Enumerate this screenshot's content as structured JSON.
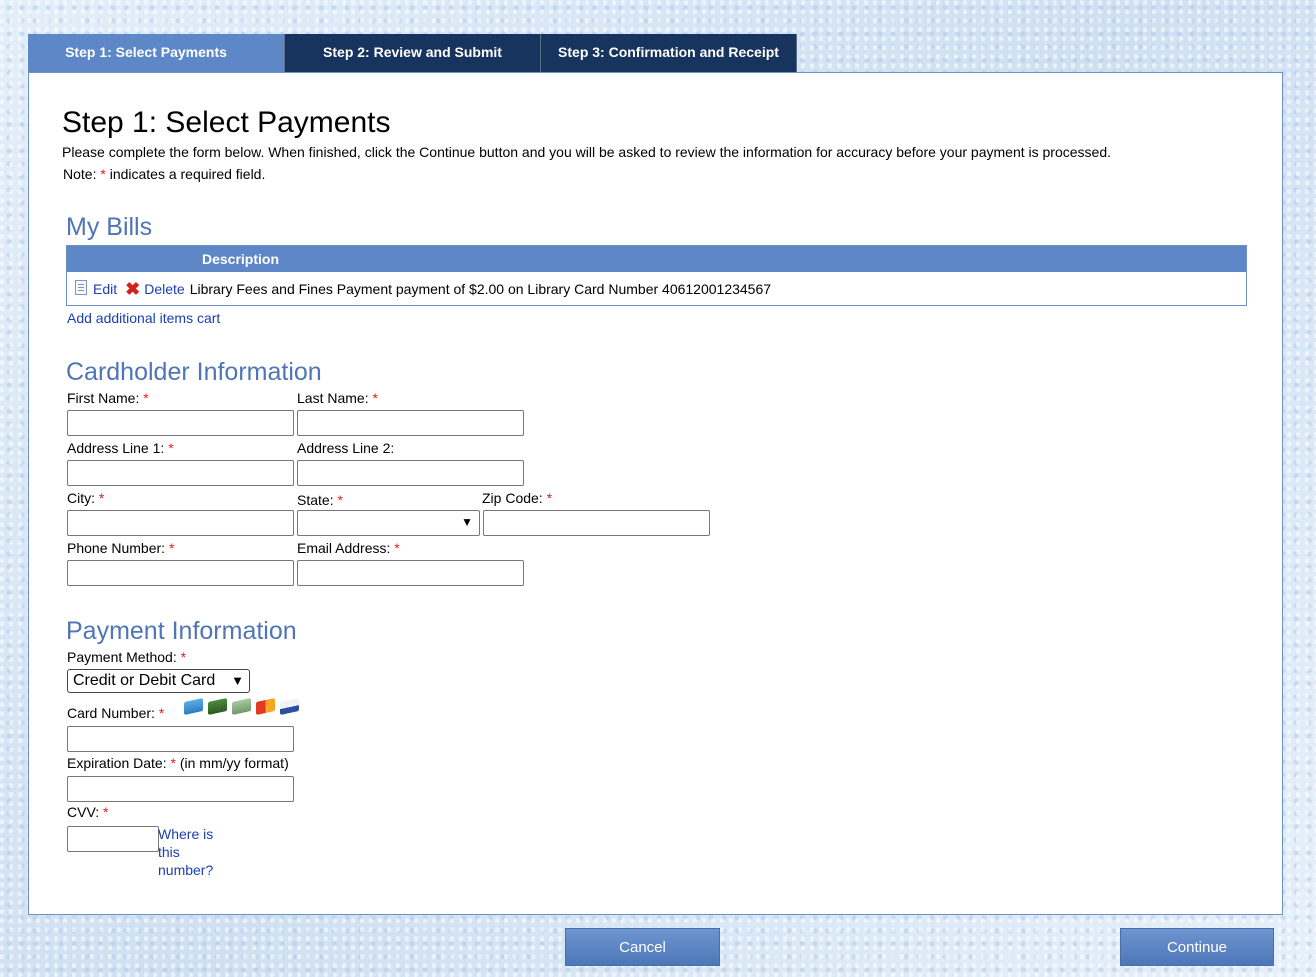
{
  "tabs": [
    {
      "label": "Step 1: Select Payments"
    },
    {
      "label": "Step 2: Review and Submit"
    },
    {
      "label": "Step 3: Confirmation and Receipt"
    }
  ],
  "page": {
    "title": "Step 1: Select Payments",
    "intro": "Please complete the form below. When finished, click the Continue button and you will be asked to review the information for accuracy before your payment is processed.",
    "note_prefix": "Note: ",
    "note_suffix": " indicates a required field.",
    "required_mark": "*"
  },
  "bills": {
    "heading": "My Bills",
    "column_header": "Description",
    "rows": [
      {
        "edit_label": "Edit",
        "delete_label": "Delete",
        "description": "Library Fees and Fines Payment payment of $2.00 on Library Card Number 40612001234567"
      }
    ],
    "add_link": "Add additional items cart"
  },
  "cardholder": {
    "heading": "Cardholder Information",
    "first_name": {
      "label": "First Name:",
      "value": ""
    },
    "last_name": {
      "label": "Last Name:",
      "value": ""
    },
    "address1": {
      "label": "Address Line 1:",
      "value": ""
    },
    "address2": {
      "label": "Address Line 2:",
      "value": ""
    },
    "city": {
      "label": "City:",
      "value": ""
    },
    "state": {
      "label": "State:",
      "value": ""
    },
    "zip": {
      "label": "Zip Code:",
      "value": ""
    },
    "phone": {
      "label": "Phone Number:",
      "value": ""
    },
    "email": {
      "label": "Email Address:",
      "value": ""
    }
  },
  "payment": {
    "heading": "Payment Information",
    "method": {
      "label": "Payment Method:",
      "selected": "Credit or Debit Card"
    },
    "card_number": {
      "label": "Card Number:",
      "value": ""
    },
    "card_icons": [
      "amex-icon",
      "discover-icon",
      "diners-icon",
      "mastercard-icon",
      "visa-icon"
    ],
    "expiration": {
      "label": "Expiration Date:",
      "hint": "(in mm/yy format)",
      "value": ""
    },
    "cvv": {
      "label": "CVV:",
      "value": "",
      "help_link": "Where is this number?"
    }
  },
  "buttons": {
    "cancel": "Cancel",
    "continue": "Continue"
  },
  "colors": {
    "tab_active": "#5d87c7",
    "tab_inactive": "#17345f",
    "section_heading": "#4f75b5",
    "required": "#e02020",
    "link": "#1a3fb0"
  }
}
